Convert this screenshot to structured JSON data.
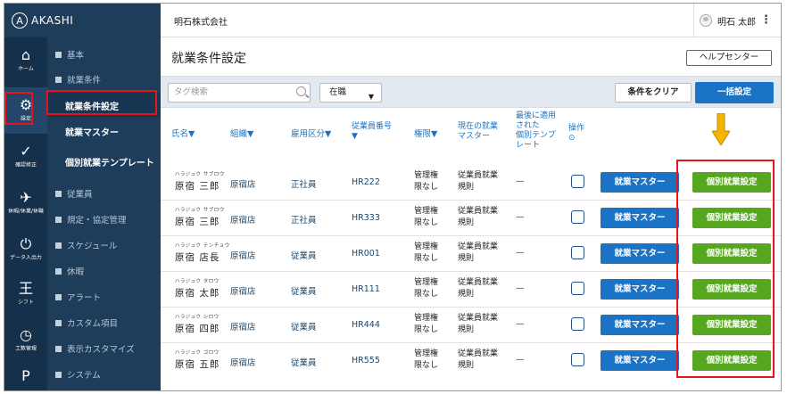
{
  "brand": {
    "name": "AKASHI",
    "logo_glyph": "A"
  },
  "topbar": {
    "company": "明石株式会社",
    "user_name": "明石 太郎",
    "menu_glyph": "⋮"
  },
  "rail": [
    {
      "icon": "home-icon",
      "glyph": "⌂",
      "label": "ホーム"
    },
    {
      "icon": "gear-icon",
      "glyph": "⚙",
      "label": "設定"
    },
    {
      "icon": "clipboard-icon",
      "glyph": "✓",
      "label": "確認修正"
    },
    {
      "icon": "send-icon",
      "glyph": "✈",
      "label": "休暇/休業/休職"
    },
    {
      "icon": "power-icon",
      "glyph": "⏻",
      "label": "データ入出力"
    },
    {
      "icon": "shift-icon",
      "glyph": "王",
      "label": "シフト"
    },
    {
      "icon": "clock-icon",
      "glyph": "◷",
      "label": "工数管理"
    },
    {
      "icon": "p-icon",
      "glyph": "P",
      "label": ""
    }
  ],
  "nav": {
    "basic": "基本",
    "work_conditions": "就業条件",
    "sub_settings": "就業条件設定",
    "sub_master": "就業マスター",
    "sub_template": "個別就業テンプレート",
    "employees": "従業員",
    "rules": "規定・協定管理",
    "schedule": "スケジュール",
    "leave": "休暇",
    "alerts": "アラート",
    "custom_items": "カスタム項目",
    "display_custom": "表示カスタマイズ",
    "system": "システム"
  },
  "main": {
    "title": "就業条件設定",
    "help_label": "ヘルプセンター",
    "tag_search_placeholder": "タグ検索",
    "status_value": "在職",
    "status_caret": "▼",
    "clear_label": "条件をクリア",
    "bulk_label": "一括設定"
  },
  "table": {
    "headers": {
      "name": "氏名▼",
      "org": "組織▼",
      "employment": "雇用区分▼",
      "emp_no_1": "従業員番号",
      "emp_no_2": "▼",
      "permission": "権限▼",
      "current_1": "現在の就業",
      "current_2": "マスター",
      "last_1": "最後に適用",
      "last_2": "された",
      "last_3": "個別テンプ",
      "last_4": "レート",
      "ops": "操作",
      "ops_icon": "⊙"
    },
    "rows": [
      {
        "kana": "ハラジュク サブロウ",
        "name": "原宿 三郎",
        "org": "原宿店",
        "employment": "正社員",
        "emp_no": "HR222",
        "perm1": "管理権",
        "perm2": "限なし",
        "cur1": "従業員就業",
        "cur2": "規則",
        "last": "—",
        "master_btn": "就業マスター",
        "indiv_btn": "個別就業設定"
      },
      {
        "kana": "ハラジュク サブロウ",
        "name": "原宿 三郎",
        "org": "原宿店",
        "employment": "正社員",
        "emp_no": "HR333",
        "perm1": "管理権",
        "perm2": "限なし",
        "cur1": "従業員就業",
        "cur2": "規則",
        "last": "—",
        "master_btn": "就業マスター",
        "indiv_btn": "個別就業設定"
      },
      {
        "kana": "ハラジュク テンチョウ",
        "name": "原宿 店長",
        "org": "原宿店",
        "employment": "従業員",
        "emp_no": "HR001",
        "perm1": "管理権",
        "perm2": "限なし",
        "cur1": "従業員就業",
        "cur2": "規則",
        "last": "—",
        "master_btn": "就業マスター",
        "indiv_btn": "個別就業設定"
      },
      {
        "kana": "ハラジュク タロウ",
        "name": "原宿 太郎",
        "org": "原宿店",
        "employment": "従業員",
        "emp_no": "HR111",
        "perm1": "管理権",
        "perm2": "限なし",
        "cur1": "従業員就業",
        "cur2": "規則",
        "last": "—",
        "master_btn": "就業マスター",
        "indiv_btn": "個別就業設定"
      },
      {
        "kana": "ハラジュク シロウ",
        "name": "原宿 四郎",
        "org": "原宿店",
        "employment": "従業員",
        "emp_no": "HR444",
        "perm1": "管理権",
        "perm2": "限なし",
        "cur1": "従業員就業",
        "cur2": "規則",
        "last": "—",
        "master_btn": "就業マスター",
        "indiv_btn": "個別就業設定"
      },
      {
        "kana": "ハラジュク ゴロウ",
        "name": "原宿 五郎",
        "org": "原宿店",
        "employment": "従業員",
        "emp_no": "HR555",
        "perm1": "管理権",
        "perm2": "限なし",
        "cur1": "従業員就業",
        "cur2": "規則",
        "last": "—",
        "master_btn": "就業マスター",
        "indiv_btn": "個別就業設定"
      }
    ]
  },
  "colors": {
    "sidebar": "#1e3d5b",
    "rail": "#15304a",
    "primary_blue": "#1a73c4",
    "action_green": "#57a61f",
    "highlight_red": "#e8141c",
    "arrow_yellow": "#f5b400"
  }
}
